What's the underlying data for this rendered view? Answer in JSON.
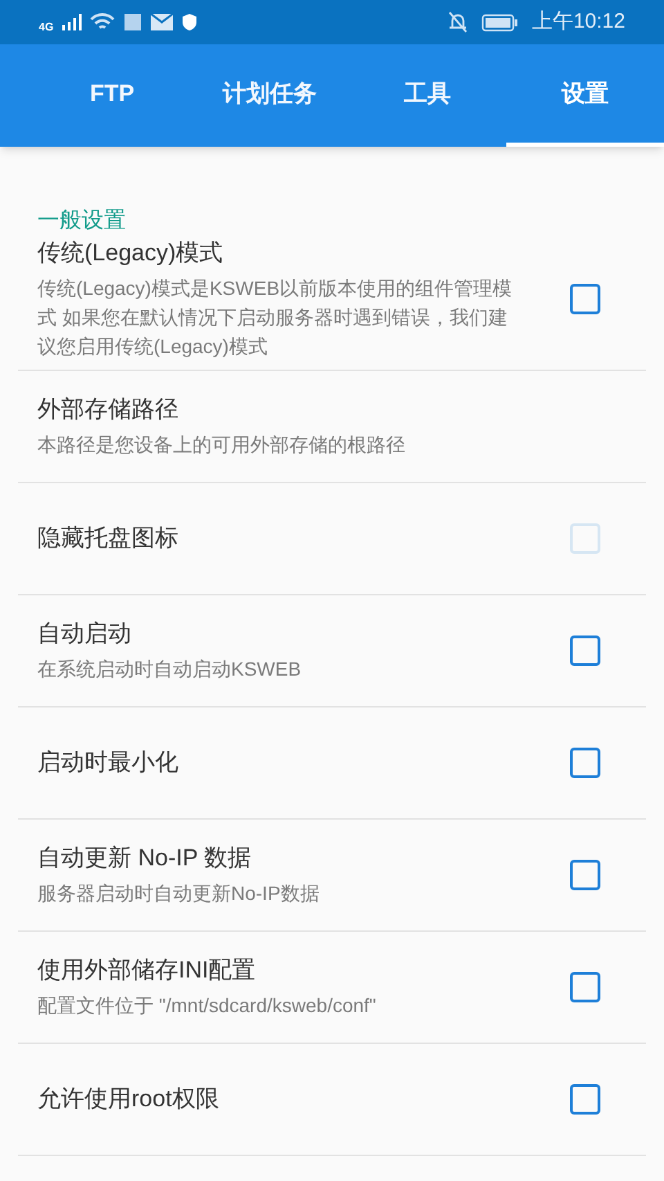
{
  "status_bar": {
    "network": "4G",
    "time": "上午10:12"
  },
  "tabs": [
    {
      "label": "FTP",
      "selected": false
    },
    {
      "label": "计划任务",
      "selected": false
    },
    {
      "label": "工具",
      "selected": false
    },
    {
      "label": "设置",
      "selected": true
    }
  ],
  "section": {
    "title": "一般设置"
  },
  "settings": [
    {
      "kind": "checkbox",
      "title": "传统(Legacy)模式",
      "summary": "传统(Legacy)模式是KSWEB以前版本使用的组件管理模式 如果您在默认情况下启动服务器时遇到错误，我们建议您启用传统(Legacy)模式",
      "checked": false,
      "disabled": false
    },
    {
      "kind": "plain",
      "title": "外部存储路径",
      "summary": "本路径是您设备上的可用外部存储的根路径"
    },
    {
      "kind": "checkbox",
      "title": "隐藏托盘图标",
      "checked": false,
      "disabled": true
    },
    {
      "kind": "checkbox",
      "title": "自动启动",
      "summary": "在系统启动时自动启动KSWEB",
      "checked": false,
      "disabled": false
    },
    {
      "kind": "checkbox",
      "title": "启动时最小化",
      "checked": false,
      "disabled": false
    },
    {
      "kind": "checkbox",
      "title": "自动更新 No-IP 数据",
      "summary": "服务器启动时自动更新No-IP数据",
      "checked": false,
      "disabled": false
    },
    {
      "kind": "checkbox",
      "title": "使用外部储存INI配置",
      "summary": "配置文件位于 \"/mnt/sdcard/ksweb/conf\"",
      "checked": false,
      "disabled": false
    },
    {
      "kind": "checkbox",
      "title": "允许使用root权限",
      "checked": false,
      "disabled": false
    }
  ]
}
